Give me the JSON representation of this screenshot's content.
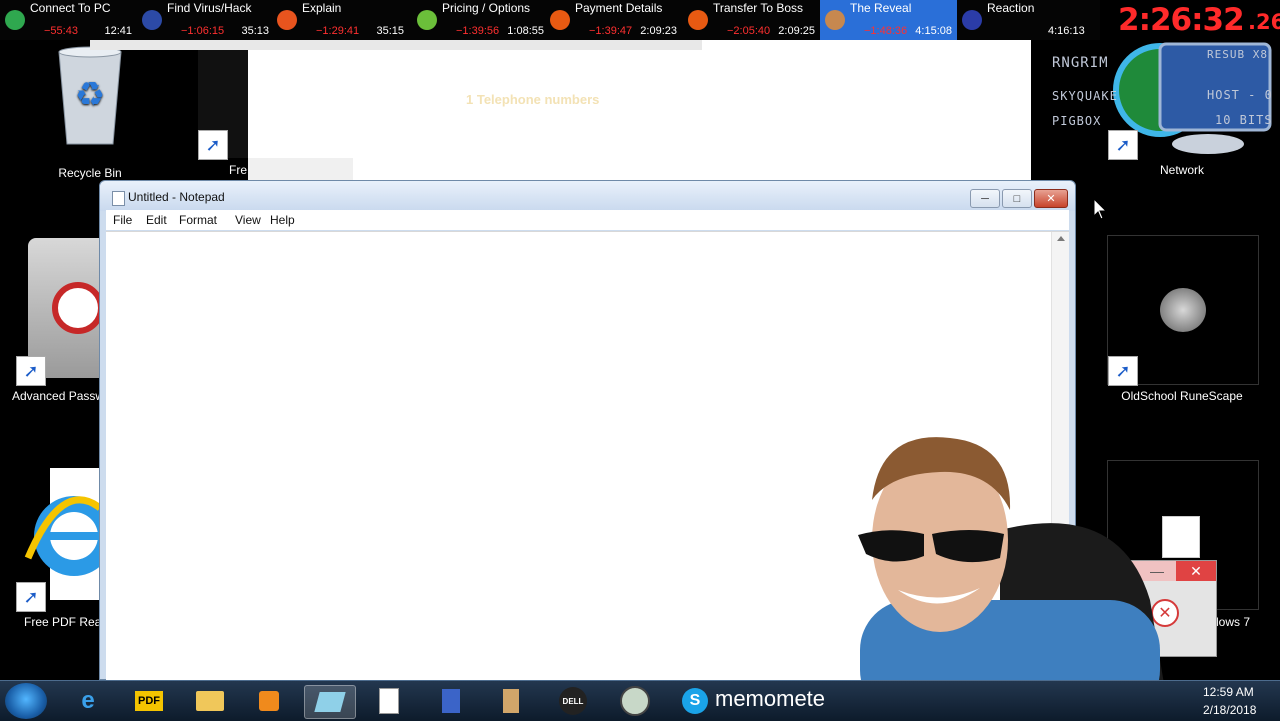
{
  "splits": {
    "items": [
      {
        "name": "Connect To PC",
        "delta": "−55:43",
        "time": "12:41",
        "color": "#2fa84f",
        "current": false
      },
      {
        "name": "Find Virus/Hack",
        "delta": "−1:06:15",
        "time": "35:13",
        "color": "#2c4aa6",
        "current": false
      },
      {
        "name": "Explain",
        "delta": "−1:29:41",
        "time": "35:15",
        "color": "#e8541e",
        "current": false
      },
      {
        "name": "Pricing / Options",
        "delta": "−1:39:56",
        "time": "1:08:55",
        "color": "#6bbf3a",
        "current": false
      },
      {
        "name": "Payment Details",
        "delta": "−1:39:47",
        "time": "2:09:23",
        "color": "#e85a12",
        "current": false
      },
      {
        "name": "Transfer To Boss",
        "delta": "−2:05:40",
        "time": "2:09:25",
        "color": "#e85a12",
        "current": false
      },
      {
        "name": "The Reveal",
        "delta": "−1:48:36",
        "time": "4:15:08",
        "color": "#c7884f",
        "current": true
      },
      {
        "name": "Reaction",
        "delta": "",
        "time": "",
        "color": "#2b3ca8",
        "current": false
      }
    ],
    "final_time": "4:16:13"
  },
  "timer": {
    "main": "2:26:32",
    "centiseconds": ".26"
  },
  "desktop": {
    "recycle_bin": "Recycle Bin",
    "fre_partial": "Fre",
    "advanced_password": "Advanced Passw",
    "free_pdf": "Free PDF Reac",
    "network": "Network",
    "osrs": "OldSchool RuneScape",
    "windows7": "dows 7"
  },
  "browser": {
    "text": "1 Telephone numbers"
  },
  "network_monitor": {
    "line1_left": "RNGRIM",
    "line1_right": "RESUB X8",
    "line2_left": "SKYQUAKE",
    "line2_right": "HOST - 0",
    "line3_left": "PIGBOX",
    "line3_right": "10 BITS"
  },
  "notepad": {
    "title": "Untitled - Notepad",
    "menu": {
      "file": "File",
      "edit": "Edit",
      "format": "Format",
      "view": "View",
      "help": "Help"
    },
    "content": ""
  },
  "taskbar": {
    "time": "12:59 AM",
    "date": "2/18/2018",
    "memo_text": "memomete",
    "pdf_label": "PDF",
    "dell_label": "DELL"
  },
  "icons": {
    "start": "windows-start-icon",
    "ie": "internet-explorer-icon",
    "skype": "skype-icon"
  }
}
